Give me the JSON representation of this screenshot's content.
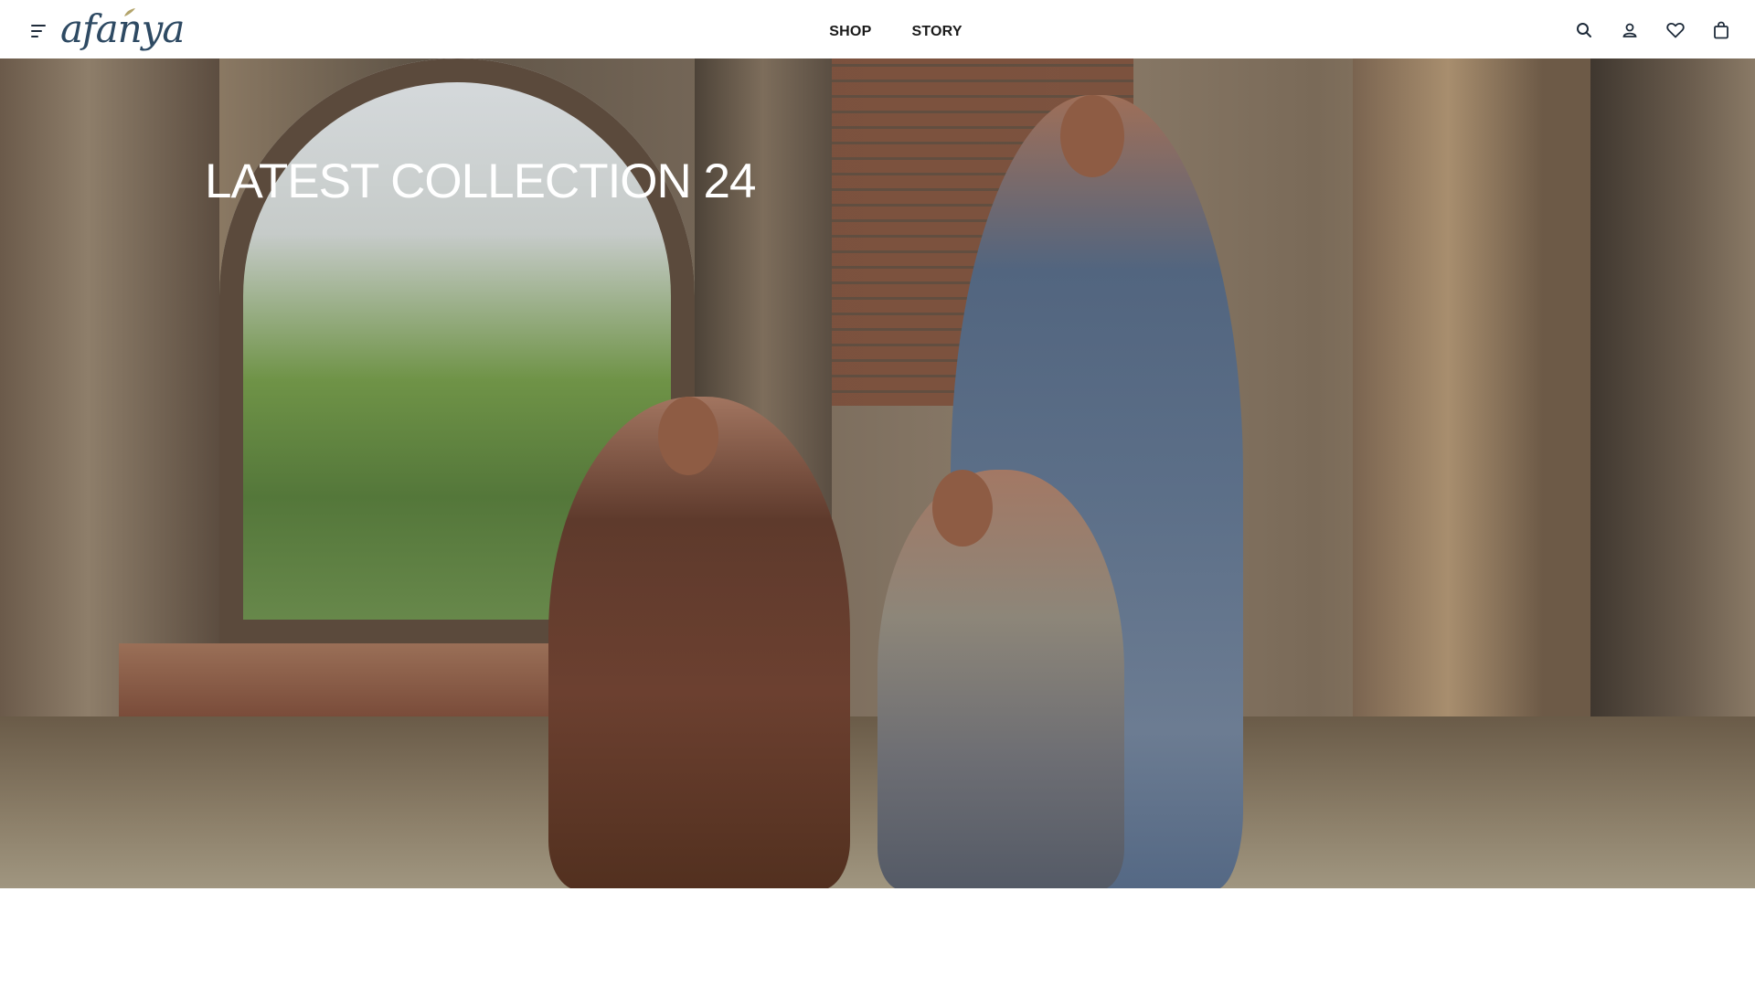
{
  "brand": {
    "logo_text": "afanya"
  },
  "nav": {
    "items": [
      {
        "label": "SHOP"
      },
      {
        "label": "STORY"
      }
    ]
  },
  "header_icons": [
    "search-icon",
    "account-icon",
    "wishlist-icon",
    "cart-icon"
  ],
  "hero": {
    "title": "LATEST COLLECTION 24"
  },
  "colors": {
    "logo": "#2e4a63",
    "nav_text": "#1a1a1a",
    "icon": "#1e2b3a",
    "hero_title": "#ffffff"
  }
}
